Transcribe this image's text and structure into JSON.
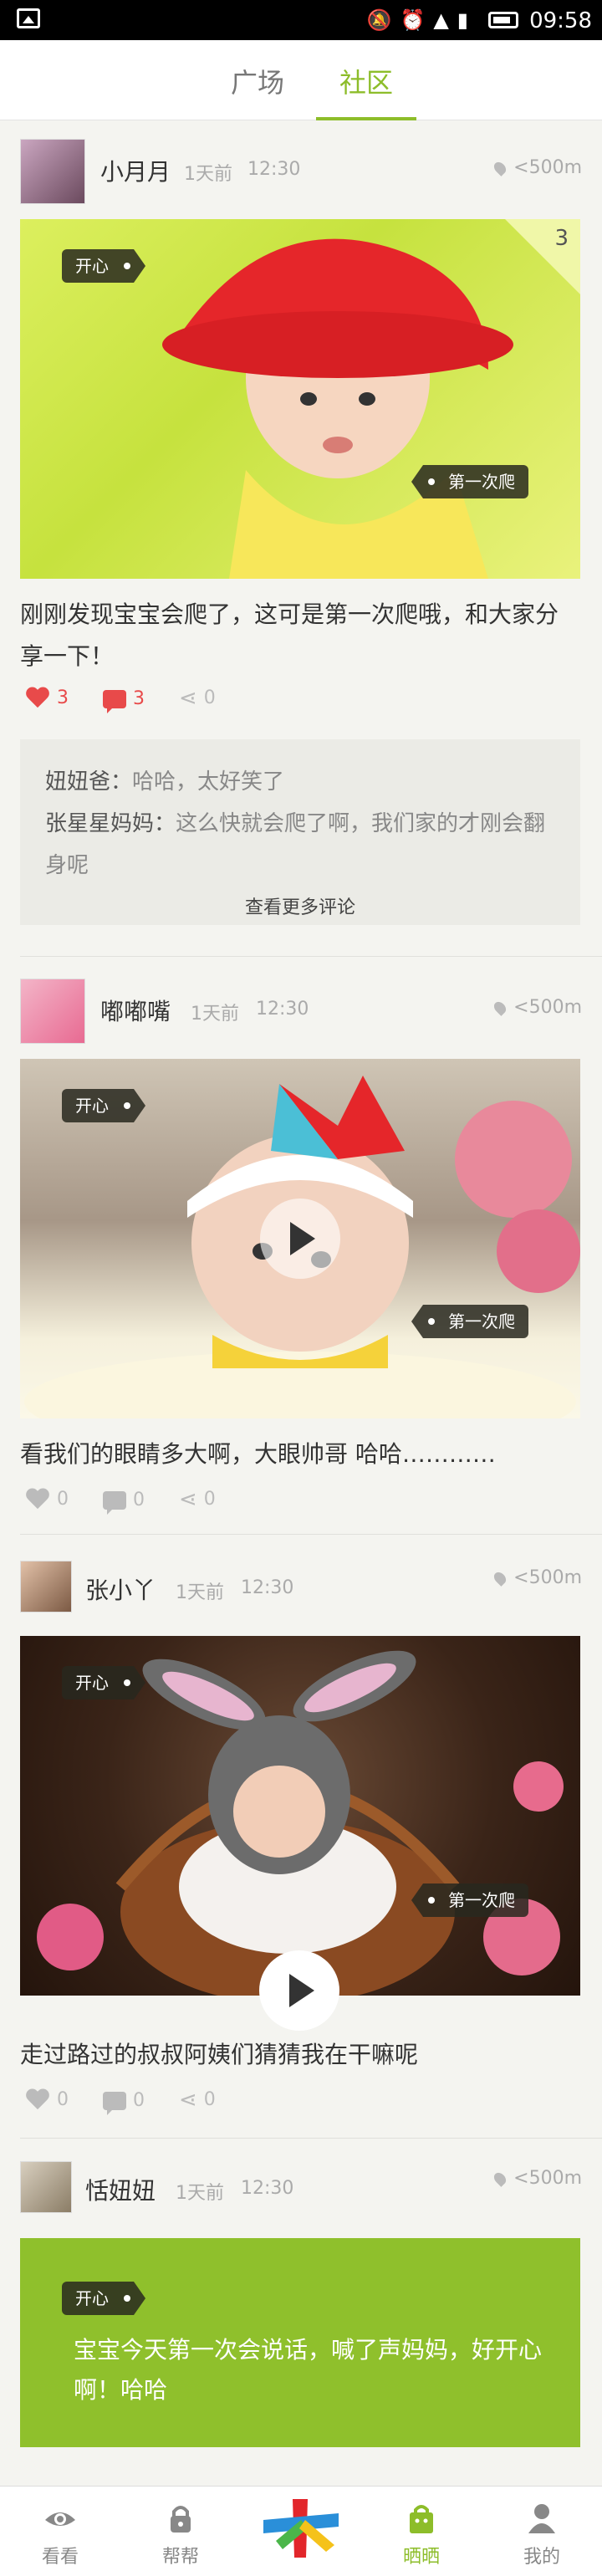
{
  "status_bar": {
    "time": "09:58"
  },
  "top_tabs": [
    {
      "label": "广场",
      "active": false
    },
    {
      "label": "社区",
      "active": true
    }
  ],
  "colors": {
    "accent": "#8dbd2a",
    "like_red": "#e84a4a"
  },
  "posts": [
    {
      "user": "小月月",
      "when": "1天前",
      "time": "12:30",
      "distance": "<500m",
      "mood_tag": "开心",
      "milestone_tag": "第一次爬",
      "photo_count": "3",
      "caption": "刚刚发现宝宝会爬了，这可是第一次爬哦，和大家分享一下！",
      "likes": "3",
      "comments_count": "3",
      "shares": "0",
      "comments": [
        {
          "user": "妞妞爸：",
          "text": "哈哈，太好笑了"
        },
        {
          "user": "张星星妈妈：",
          "text": "这么快就会爬了啊，我们家的才刚会翻身呢"
        }
      ],
      "more_comments": "查看更多评论"
    },
    {
      "user": "嘟嘟嘴",
      "when": "1天前",
      "time": "12:30",
      "distance": "<500m",
      "mood_tag": "开心",
      "milestone_tag": "第一次爬",
      "caption": "看我们的眼睛多大啊，大眼帅哥  哈哈…………",
      "likes": "0",
      "comments_count": "0",
      "shares": "0"
    },
    {
      "user": "张小丫",
      "when": "1天前",
      "time": "12:30",
      "distance": "<500m",
      "mood_tag": "开心",
      "milestone_tag": "第一次爬",
      "caption": "走过路过的叔叔阿姨们猜猜我在干嘛呢",
      "likes": "0",
      "comments_count": "0",
      "shares": "0"
    },
    {
      "user": "恬妞妞",
      "when": "1天前",
      "time": "12:30",
      "distance": "<500m",
      "mood_tag": "开心",
      "text": "宝宝今天第一次会说话，喊了声妈妈，好开心啊！哈哈"
    }
  ],
  "bottom_nav": [
    {
      "label": "看看",
      "icon": "eye-icon",
      "active": false
    },
    {
      "label": "帮帮",
      "icon": "lock-icon",
      "active": false
    },
    {
      "label": "",
      "icon": "app-logo-icon",
      "active": false
    },
    {
      "label": "晒晒",
      "icon": "shopping-bag-icon",
      "active": true
    },
    {
      "label": "我的",
      "icon": "person-icon",
      "active": false
    }
  ]
}
